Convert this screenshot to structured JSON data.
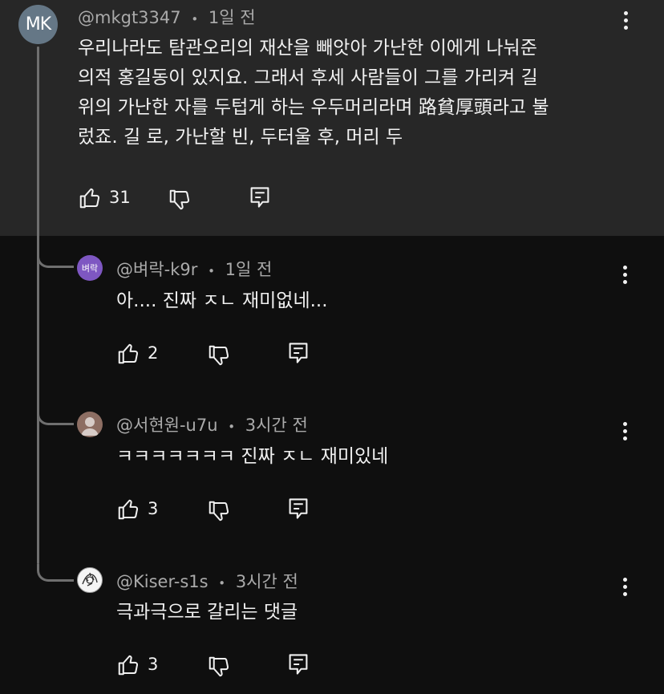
{
  "top_comment": {
    "avatar_initials": "MK",
    "author": "@mkgt3347",
    "separator": "•",
    "time": "1일 전",
    "lines": [
      "우리나라도 탐관오리의 재산을 빼앗아 가난한 이에게 나눠준",
      "의적 홍길동이 있지요. 그래서 후세 사람들이 그를 가리켜 길",
      "위의 가난한 자를 두텁게 하는 우두머리라며 路貧厚頭라고 불",
      "렀죠. 길 로, 가난할 빈, 두터울 후, 머리 두"
    ],
    "likes": "31"
  },
  "replies": [
    {
      "avatar_text": "벼락",
      "author": "@벼락-k9r",
      "separator": "•",
      "time": "1일 전",
      "text": "아.... 진짜 ㅈㄴ 재미없네...",
      "likes": "2"
    },
    {
      "author": "@서현원-u7u",
      "separator": "•",
      "time": "3시간 전",
      "text": "ㅋㅋㅋㅋㅋㅋㅋ 진짜 ㅈㄴ 재미있네",
      "likes": "3"
    },
    {
      "author": "@Kiser-s1s",
      "separator": "•",
      "time": "3시간 전",
      "text": "극과극으로 갈리는 댓글",
      "likes": "3"
    }
  ],
  "icons": {
    "like": "thumbs-up-icon",
    "dislike": "thumbs-down-icon",
    "reply": "reply-comment-icon",
    "more": "more-vertical-icon"
  },
  "colors": {
    "page_bg": "#0f0f0f",
    "highlight_bg": "#272727",
    "primary_text": "#f1f1f1",
    "secondary_text": "#aaaaaa",
    "thread_line": "#6f6f6f"
  }
}
